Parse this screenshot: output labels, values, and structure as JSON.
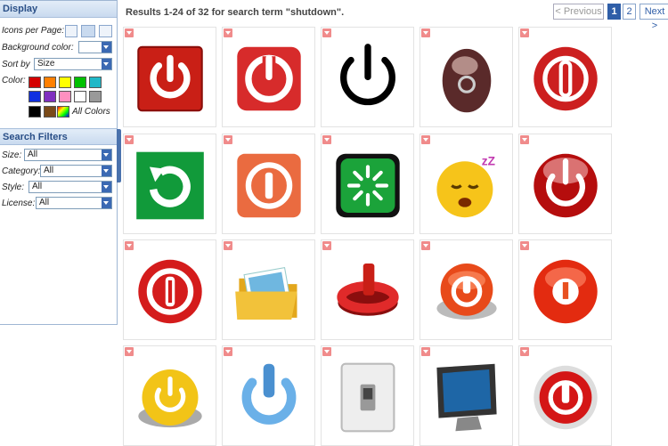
{
  "sidebar": {
    "display_title": "Display",
    "icons_per_page_label": "Icons per Page:",
    "background_color_label": "Background color:",
    "background_color_value": "",
    "sort_by_label": "Sort by",
    "sort_by_value": "Size",
    "color_label": "Color:",
    "colors": [
      "#d40000",
      "#ff8000",
      "#ffff00",
      "#00c000",
      "#20b8c8",
      "#1030e0",
      "#8030c0",
      "#ff90c0",
      "#ffffff",
      "#999999",
      "#000000",
      "#7a4a18"
    ],
    "all_colors_label": "All Colors",
    "filters_title": "Search Filters",
    "size_label": "Size:",
    "size_value": "All",
    "category_label": "Category:",
    "category_value": "All",
    "style_label": "Style:",
    "style_value": "All",
    "license_label": "License:",
    "license_value": "All"
  },
  "header": {
    "results_text": "Results 1-24 of 32 for search term \"shutdown\".",
    "pagination": {
      "previous": "< Previous",
      "page1": "1",
      "page2": "2",
      "next": "Next >"
    }
  },
  "icons": [
    "power-button-red-square-icon",
    "power-button-red-rounded-icon",
    "power-symbol-black-icon",
    "glossy-brown-orb-icon",
    "power-button-red-circle-icon",
    "restart-green-arrow-icon",
    "power-button-orange-tile-icon",
    "loading-green-button-icon",
    "sleeping-emoji-icon",
    "power-button-glossy-red-icon",
    "power-button-red-icon",
    "folder-open-icon",
    "power-symbol-3d-red-icon",
    "power-button-orange-3d-icon",
    "power-button-red-3d-icon",
    "power-button-yellow-icon",
    "power-symbol-blue-glass-icon",
    "light-switch-icon",
    "computer-monitor-icon",
    "power-button-red-chrome-icon"
  ]
}
